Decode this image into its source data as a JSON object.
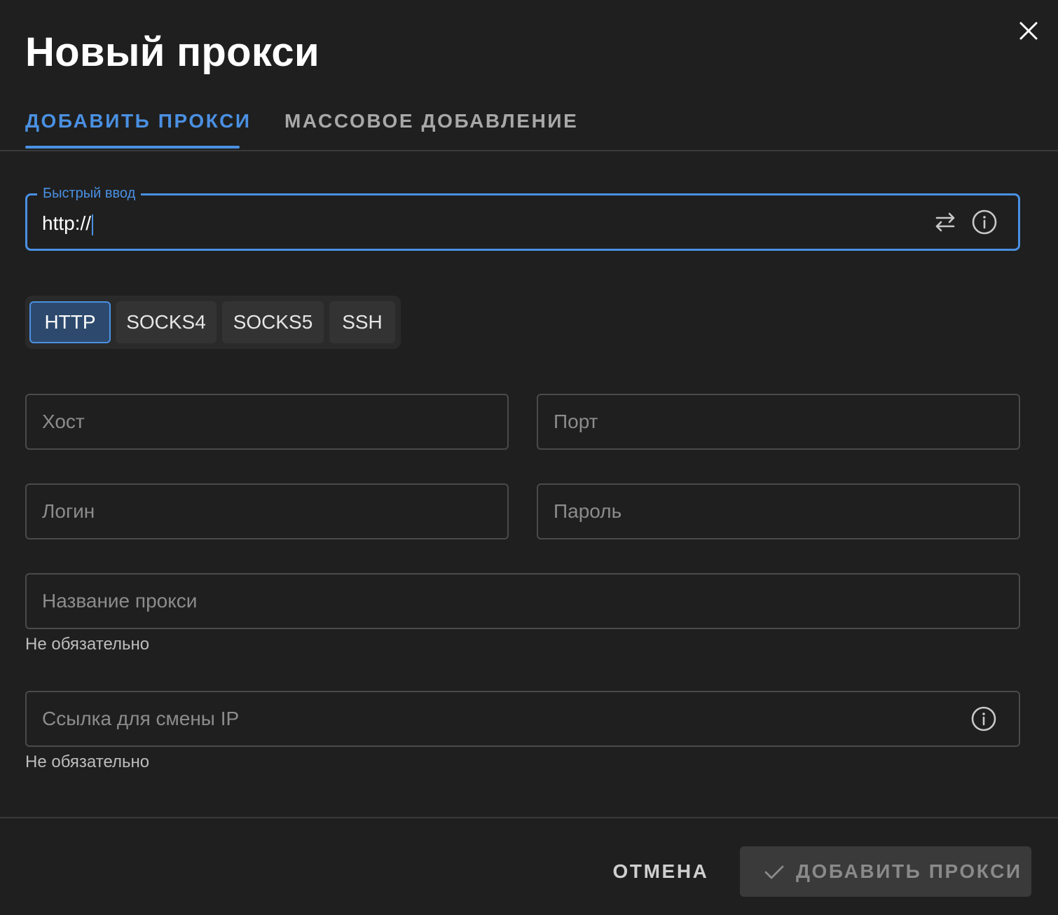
{
  "dialog": {
    "title": "Новый прокси",
    "close_icon": "close-icon"
  },
  "tabs": [
    {
      "label": "ДОБАВИТЬ ПРОКСИ",
      "active": true
    },
    {
      "label": "МАССОВОЕ ДОБАВЛЕНИЕ",
      "active": false
    }
  ],
  "quick_input": {
    "legend": "Быстрый ввод",
    "value": "http://",
    "icons": [
      "swap-icon",
      "info-icon"
    ]
  },
  "protocols": {
    "options": [
      "HTTP",
      "SOCKS4",
      "SOCKS5",
      "SSH"
    ],
    "selected": "HTTP"
  },
  "fields": {
    "host": {
      "placeholder": "Хост"
    },
    "port": {
      "placeholder": "Порт"
    },
    "login": {
      "placeholder": "Логин"
    },
    "password": {
      "placeholder": "Пароль"
    },
    "name": {
      "placeholder": "Название прокси",
      "helper": "Не обязательно"
    },
    "ip_change_link": {
      "placeholder": "Ссылка для смены IP",
      "helper": "Не обязательно"
    }
  },
  "footer": {
    "cancel_label": "ОТМЕНА",
    "submit_label": "ДОБАВИТЬ ПРОКСИ",
    "submit_icon": "check-icon"
  },
  "colors": {
    "accent": "#4a90e2",
    "background": "#1f1f1f",
    "selected_segment": "#2d4a6e"
  }
}
